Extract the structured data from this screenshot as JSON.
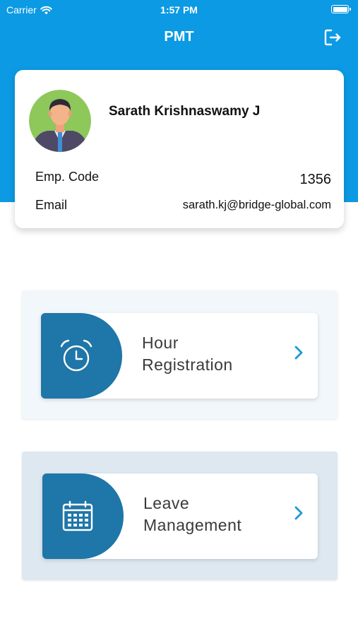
{
  "status_bar": {
    "carrier": "Carrier",
    "time": "1:57 PM",
    "wifi_icon": "wifi-icon",
    "battery_icon": "battery-icon"
  },
  "nav": {
    "title": "PMT",
    "logout_icon": "logout-icon"
  },
  "profile": {
    "name": "Sarath Krishnaswamy J",
    "emp_code_label": "Emp. Code",
    "emp_code_value": "1356",
    "email_label": "Email",
    "email_value": "sarath.kj@bridge-global.com"
  },
  "menu": [
    {
      "line1": "Hour",
      "line2": "Registration",
      "icon": "alarm-clock-icon",
      "chevron": "chevron-right-icon"
    },
    {
      "line1": "Leave",
      "line2": "Management",
      "icon": "calendar-icon",
      "chevron": "chevron-right-icon"
    }
  ],
  "colors": {
    "header": "#0b9ae3",
    "menu_accent": "#1f76a8",
    "chevron": "#1a9ad6"
  }
}
